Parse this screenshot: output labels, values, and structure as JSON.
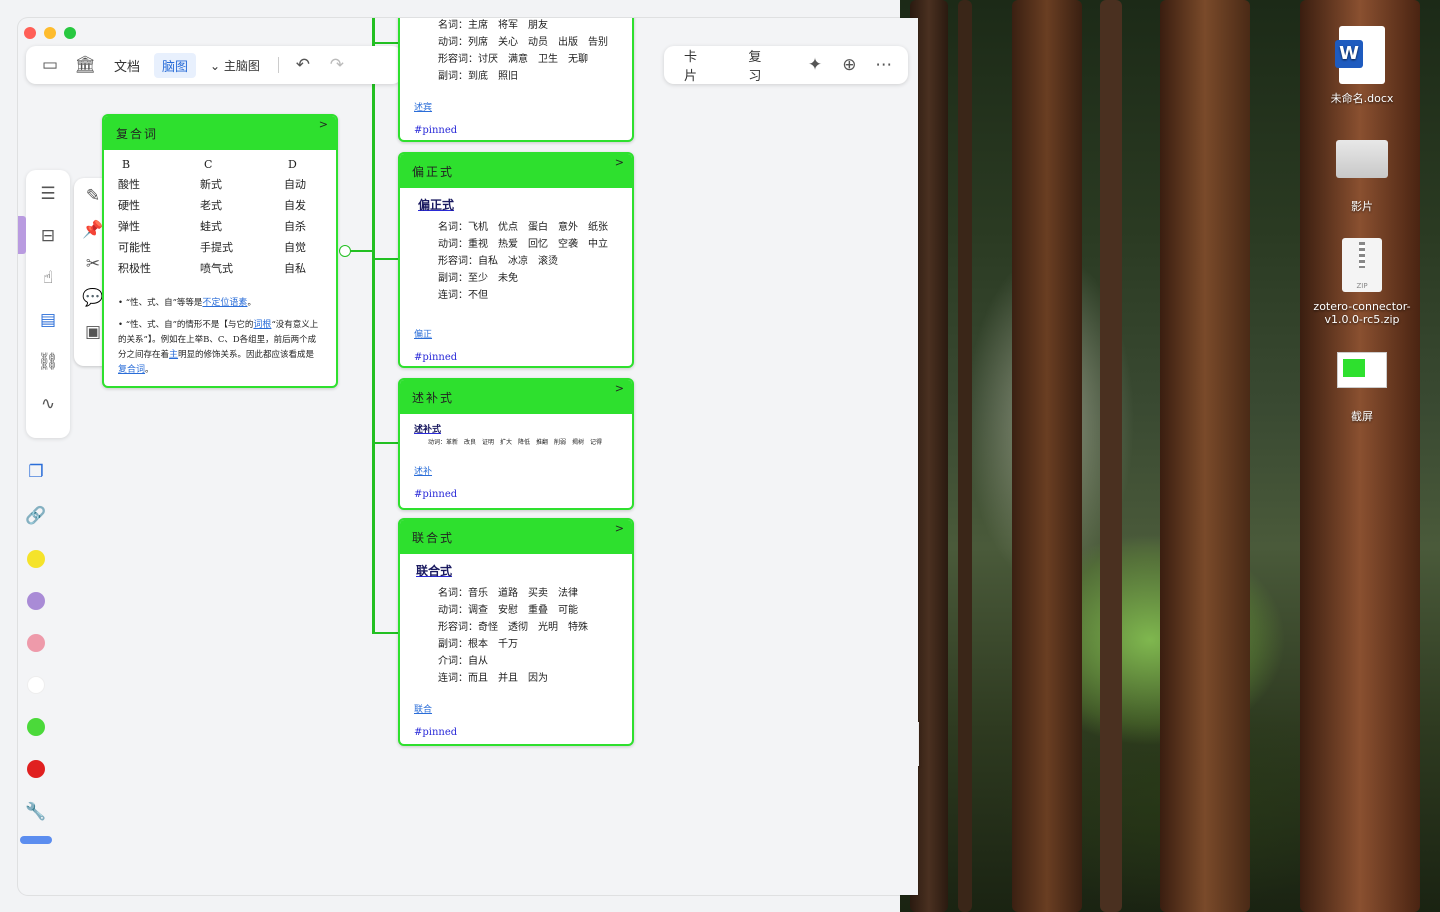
{
  "toolbar": {
    "doc": "文档",
    "mindmap": "脑图",
    "theme": "主脑图"
  },
  "rightbar": {
    "card": "卡片",
    "review": "复习"
  },
  "node_compound": {
    "title": "复合词",
    "cols": [
      "B",
      "C",
      "D"
    ],
    "rows": [
      [
        "酸性",
        "新式",
        "自动"
      ],
      [
        "硬性",
        "老式",
        "自发"
      ],
      [
        "弹性",
        "蛙式",
        "自杀"
      ],
      [
        "可能性",
        "手提式",
        "自觉"
      ],
      [
        "积极性",
        "喷气式",
        "自私"
      ]
    ],
    "note1_pre": "“性、式、自”等等是",
    "note1_link": "不定位语素",
    "note1_post": "。",
    "note2_a": "“性、式、自”的情形不是【与它的",
    "note2_link1": "词根",
    "note2_b": "“没有意义上的关系”】。例如在上举B、C、D各组里，前后两个成分之间存在着",
    "note2_link2": "主",
    "note2_c": "明显的修饰关系。因此都应该看成是",
    "note2_link3": "复合词",
    "note2_d": "。"
  },
  "node_top": {
    "lines": [
      "名词：主席　将军　朋友",
      "动词：列席　关心　动员　出版　告别",
      "形容词：讨厌　满意　卫生　无聊",
      "副词：到底　照旧"
    ],
    "link": "述宾",
    "pin": "#pinned"
  },
  "node_pz": {
    "title": "偏正式",
    "sub": "偏正式",
    "lines": [
      "名词：飞机　优点　蛋白　意外　纸张",
      "动词：重视　热爱　回忆　空袭　中立",
      "形容词：自私　冰凉　滚烫",
      "副词：至少　未免",
      "连词：不但"
    ],
    "link": "偏正",
    "pin": "#pinned"
  },
  "node_sb": {
    "title": "述补式",
    "sub": "述补式",
    "line": "动词：革新　改良　证明　扩大　降低　推翻　削弱　揭树　记得",
    "link": "述补",
    "pin": "#pinned"
  },
  "node_lh": {
    "title": "联合式",
    "sub": "联合式",
    "lines": [
      "名词：音乐　道路　买卖　法律",
      "动词：调查　安慰　重叠　可能",
      "形容词：奇怪　透彻　光明　特殊",
      "副词：根本　千万",
      "介词：自从",
      "连词：而且　并且　因为"
    ],
    "link": "联合",
    "pin": "#pinned"
  },
  "desktop": {
    "docx": "未命名.docx",
    "movies": "影片",
    "zip1": "zotero-connector-",
    "zip2": "v1.0.0-rc5.zip",
    "zip_tag": "ZIP",
    "shot": "截屏"
  },
  "colors": {
    "node_green": "#2ee02e",
    "accent_blue": "#2a6dd8"
  }
}
